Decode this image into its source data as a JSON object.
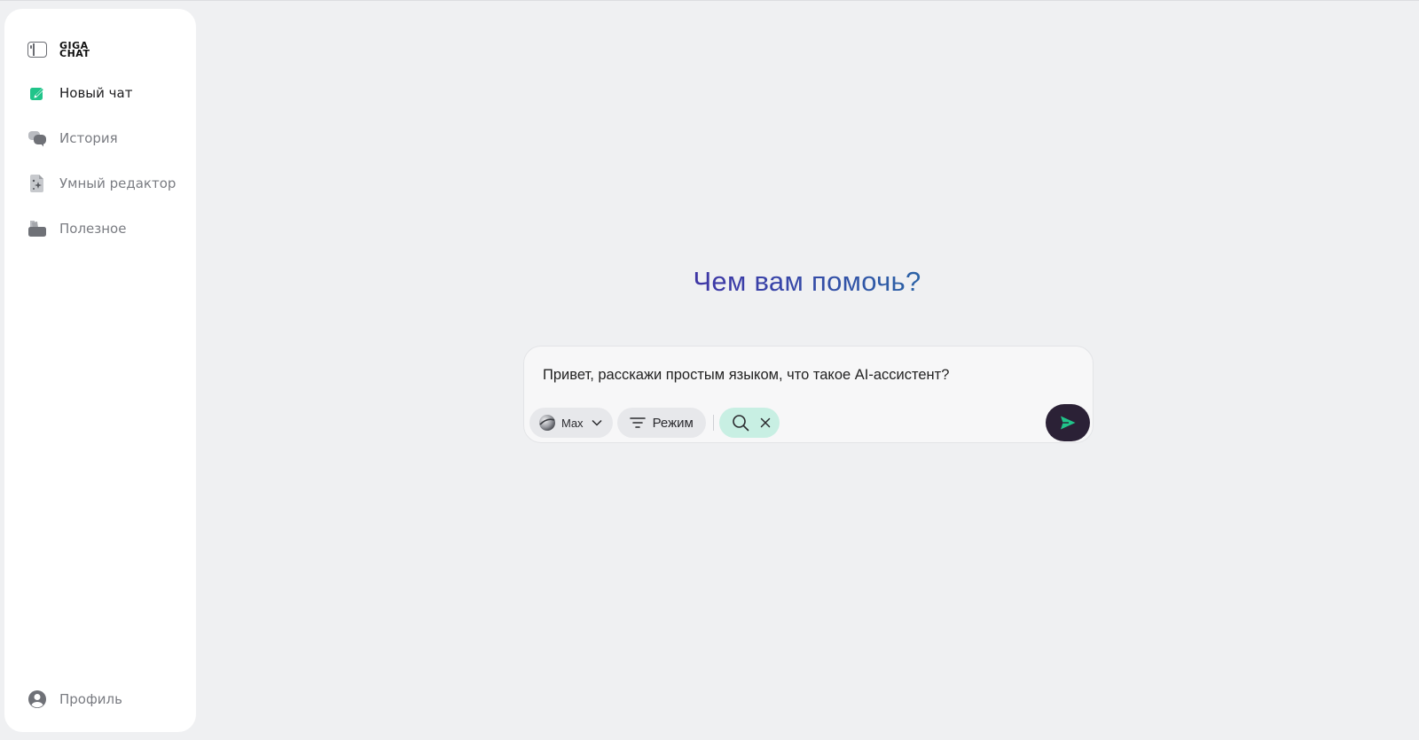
{
  "app": {
    "logo_line1": "GIGA",
    "logo_line2": "CHAT"
  },
  "sidebar": {
    "items": [
      {
        "label": "Новый чат",
        "icon": "pencil-icon",
        "active": true
      },
      {
        "label": "История",
        "icon": "chat-bubbles-icon",
        "active": false
      },
      {
        "label": "Умный редактор",
        "icon": "sparkle-document-icon",
        "active": false
      },
      {
        "label": "Полезное",
        "icon": "folder-tools-icon",
        "active": false
      }
    ],
    "profile_label": "Профиль"
  },
  "main": {
    "greeting": "Чем вам помочь?",
    "composer": {
      "value": "Привет, расскажи простым языком, что такое AI-ассистент?",
      "model_label": "Max",
      "mode_label": "Режим"
    }
  },
  "colors": {
    "accent_green": "#21c48a",
    "send_button": "#2b2136",
    "search_chip": "#c8efe3"
  }
}
